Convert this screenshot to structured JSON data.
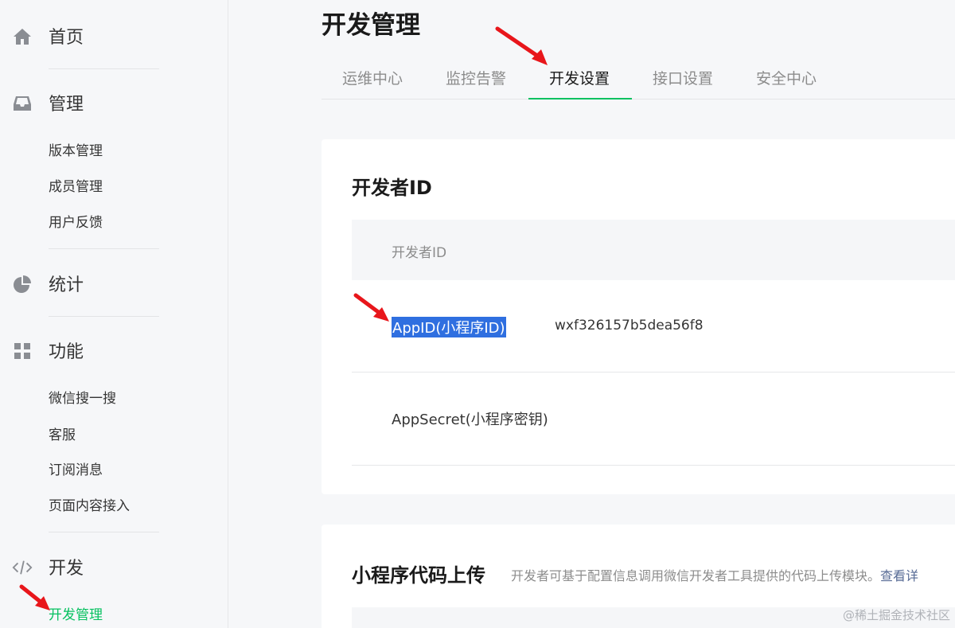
{
  "sidebar": {
    "home": {
      "label": "首页",
      "icon": "home-icon"
    },
    "manage": {
      "label": "管理",
      "icon": "inbox-icon",
      "items": [
        "版本管理",
        "成员管理",
        "用户反馈"
      ]
    },
    "stats": {
      "label": "统计",
      "icon": "pie-chart-icon"
    },
    "features": {
      "label": "功能",
      "icon": "grid-icon",
      "items": [
        "微信搜一搜",
        "客服",
        "订阅消息",
        "页面内容接入"
      ]
    },
    "develop": {
      "label": "开发",
      "icon": "code-icon",
      "items": [
        "开发管理"
      ],
      "active_item": "开发管理"
    }
  },
  "page": {
    "title": "开发管理"
  },
  "tabs": [
    "运维中心",
    "监控告警",
    "开发设置",
    "接口设置",
    "安全中心"
  ],
  "active_tab": "开发设置",
  "developer_id_card": {
    "title": "开发者ID",
    "table_header": "开发者ID",
    "rows": [
      {
        "key": "AppID(小程序ID)",
        "value": "wxf326157b5dea56f8",
        "selected": true
      },
      {
        "key": "AppSecret(小程序密钥)",
        "value": ""
      }
    ]
  },
  "upload_card": {
    "title": "小程序代码上传",
    "description": "开发者可基于配置信息调用微信开发者工具提供的代码上传模块。",
    "link": "查看详"
  },
  "watermark": "@稀土掘金技术社区",
  "colors": {
    "accent": "#07c160",
    "selection": "#2f6fe0",
    "annotation_arrow": "#e8161b",
    "link": "#576b95"
  }
}
